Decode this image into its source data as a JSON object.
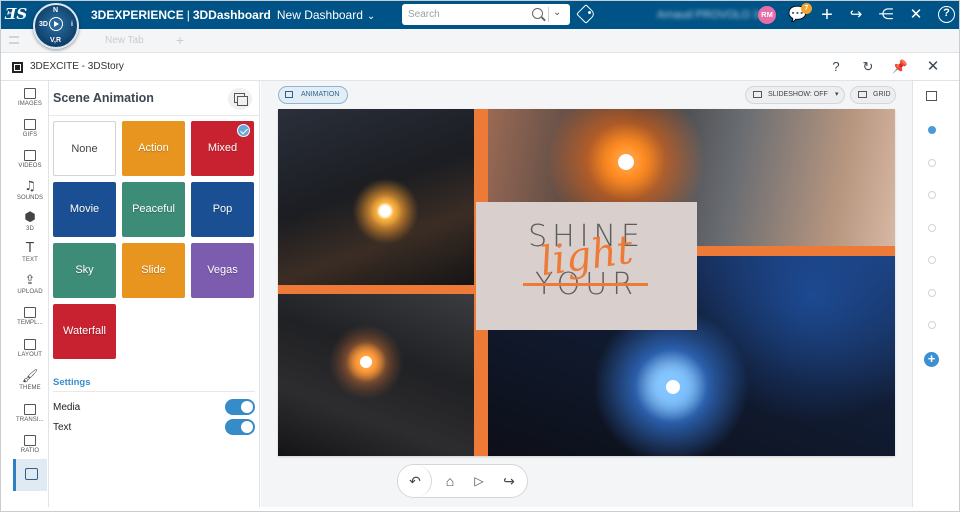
{
  "topbar": {
    "brand_3d": "3DEXPERIENCE",
    "brand_sep": "|",
    "brand_app": "3DDashboard",
    "dashboard_name": "New Dashboard",
    "search_placeholder": "Search",
    "username": "Arnaud PROVOLO 3",
    "avatar_initials": "RM",
    "notification_count": "7",
    "compass": {
      "north": "N",
      "west": "3D",
      "east": "i",
      "south": "V,R"
    }
  },
  "tabbar": {
    "tab_label": "New Tab"
  },
  "widget": {
    "title": "3DEXCITE - 3DStory"
  },
  "rail": {
    "items": [
      {
        "label": "IMAGES",
        "icon": "image-icon"
      },
      {
        "label": "GIFS",
        "icon": "gif-icon"
      },
      {
        "label": "VIDEOS",
        "icon": "video-icon"
      },
      {
        "label": "SOUNDS",
        "icon": "music-icon"
      },
      {
        "label": "3D",
        "icon": "cube-icon"
      },
      {
        "label": "TEXT",
        "icon": "text-icon"
      },
      {
        "label": "UPLOAD",
        "icon": "upload-icon"
      },
      {
        "label": "TEMPL...",
        "icon": "template-icon"
      },
      {
        "label": "LAYOUT",
        "icon": "layout-icon"
      },
      {
        "label": "THEME",
        "icon": "theme-icon"
      },
      {
        "label": "TRANSI...",
        "icon": "transition-icon"
      },
      {
        "label": "RATIO",
        "icon": "ratio-icon"
      }
    ]
  },
  "panel": {
    "title": "Scene Animation",
    "tiles": [
      {
        "label": "None",
        "color": "#ffffff"
      },
      {
        "label": "Action",
        "color": "#e7951f"
      },
      {
        "label": "Mixed",
        "color": "#c8212f",
        "selected": true
      },
      {
        "label": "Movie",
        "color": "#1b4f93"
      },
      {
        "label": "Peaceful",
        "color": "#3d8c77"
      },
      {
        "label": "Pop",
        "color": "#1b4f93"
      },
      {
        "label": "Sky",
        "color": "#3d8c77"
      },
      {
        "label": "Slide",
        "color": "#e7951f"
      },
      {
        "label": "Vegas",
        "color": "#7b5cae"
      },
      {
        "label": "Waterfall",
        "color": "#c8212f"
      }
    ],
    "settings_label": "Settings",
    "toggles": [
      {
        "label": "Media",
        "on": true
      },
      {
        "label": "Text",
        "on": true
      }
    ]
  },
  "canvas": {
    "animation_label": "ANIMATION",
    "slideshow_label": "SLIDESHOW: OFF",
    "grid_label": "GRID",
    "story": {
      "line1": "SHINE",
      "line2": "light",
      "line3": "YOUR"
    },
    "accent": "#ee7a38"
  },
  "slides": {
    "count": 7,
    "active_index": 0,
    "accent": "#4a9ad6"
  }
}
